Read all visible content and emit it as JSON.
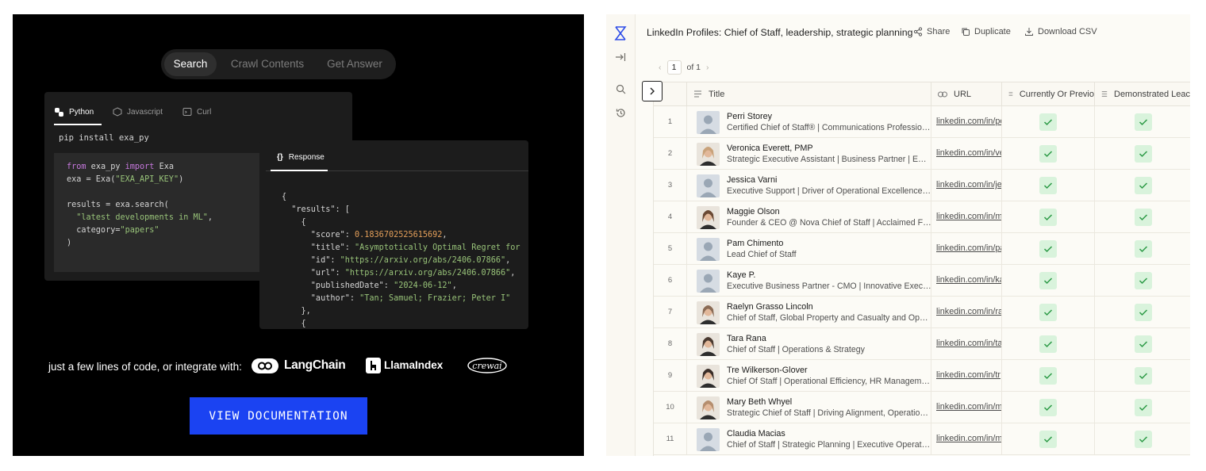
{
  "exa": {
    "tabs": [
      "Search",
      "Crawl Contents",
      "Get Answer"
    ],
    "code_tabs": [
      "Python",
      "Javascript",
      "Curl"
    ],
    "install_cmd": "pip install exa_py",
    "response_tab": "Response",
    "integrate_text": "just a few lines of code, or integrate with:",
    "partners": [
      "LangChain",
      "LlamaIndex",
      "crewai"
    ],
    "doc_button": "VIEW DOCUMENTATION"
  },
  "websets": {
    "title": "LinkedIn Profiles: Chief of Staff, leadership, strategic planning",
    "actions": {
      "share": "Share",
      "duplicate": "Duplicate",
      "download": "Download CSV"
    },
    "pager": {
      "page": "1",
      "of": "of 1"
    },
    "columns": {
      "title": "Title",
      "url": "URL",
      "col1": "Currently Or Previo",
      "col2": "Demonstrated Leac"
    },
    "rows": [
      {
        "n": "1",
        "name": "Perri Storey",
        "sub": "Certified Chief of Staff® | Communications Professional...",
        "url": "linkedin.com/in/pe"
      },
      {
        "n": "2",
        "name": "Veronica Everett, PMP",
        "sub": "Strategic Executive Assistant | Business Partner | Empo...",
        "url": "linkedin.com/in/ve"
      },
      {
        "n": "3",
        "name": "Jessica Varni",
        "sub": "Executive Support | Driver of Operational Excellence | C...",
        "url": "linkedin.com/in/je"
      },
      {
        "n": "4",
        "name": "Maggie Olson",
        "sub": "Founder & CEO @ Nova Chief of Staff | Acclaimed Fortu...",
        "url": "linkedin.com/in/m"
      },
      {
        "n": "5",
        "name": "Pam Chimento",
        "sub": "Lead Chief of Staff",
        "url": "linkedin.com/in/pa"
      },
      {
        "n": "6",
        "name": "Kaye P.",
        "sub": "Executive Business Partner - CMO | Innovative Executiv...",
        "url": "linkedin.com/in/ka"
      },
      {
        "n": "7",
        "name": "Raelyn Grasso Lincoln",
        "sub": "Chief of Staff, Global Property and Casualty and Operati...",
        "url": "linkedin.com/in/ra"
      },
      {
        "n": "8",
        "name": "Tara Rana",
        "sub": "Chief of Staff | Operations & Strategy",
        "url": "linkedin.com/in/ta"
      },
      {
        "n": "9",
        "name": "Tre Wilkerson-Glover",
        "sub": "Chief Of Staff | Operational Efficiency, HR Management",
        "url": "linkedin.com/in/tr"
      },
      {
        "n": "10",
        "name": "Mary Beth Whyel",
        "sub": "Strategic Chief of Staff | Driving Alignment, Operational...",
        "url": "linkedin.com/in/m"
      },
      {
        "n": "11",
        "name": "Claudia Macias",
        "sub": "Chief of Staff | Strategic Planning | Executive Operation...",
        "url": "linkedin.com/in/m"
      }
    ]
  }
}
